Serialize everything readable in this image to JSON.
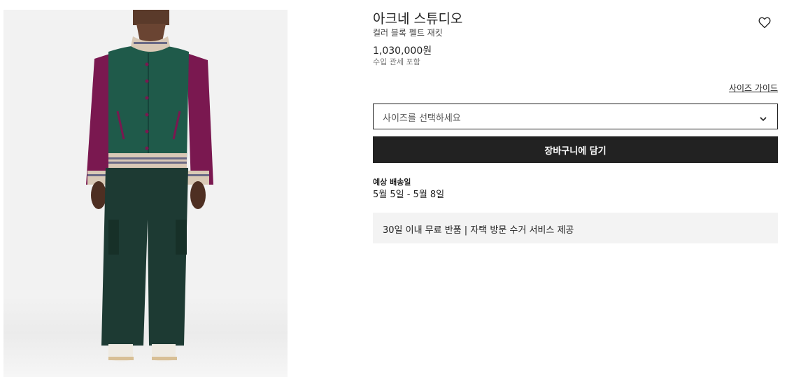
{
  "product": {
    "brand": "아크네 스튜디오",
    "name": "컬러 블록 펠트 재킷",
    "price": "1,030,000원",
    "tax_note": "수입 관세 포함"
  },
  "size": {
    "guide_label": "사이즈 가이드",
    "placeholder": "사이즈를 선택하세요"
  },
  "cart": {
    "add_label": "장바구니에 담기"
  },
  "delivery": {
    "label": "예상 배송일",
    "dates": "5월 5일 - 5월 8일"
  },
  "returns": {
    "text": "30일 이내 무료 반품 | 자택 방문 수거 서비스 제공"
  },
  "icons": {
    "wishlist": "heart-icon",
    "size_dropdown": "chevron-down-icon"
  },
  "colors": {
    "jacket_body": "#1f5a4a",
    "jacket_sleeves": "#7a1850",
    "trousers": "#1d3a33",
    "button": "#222222"
  }
}
